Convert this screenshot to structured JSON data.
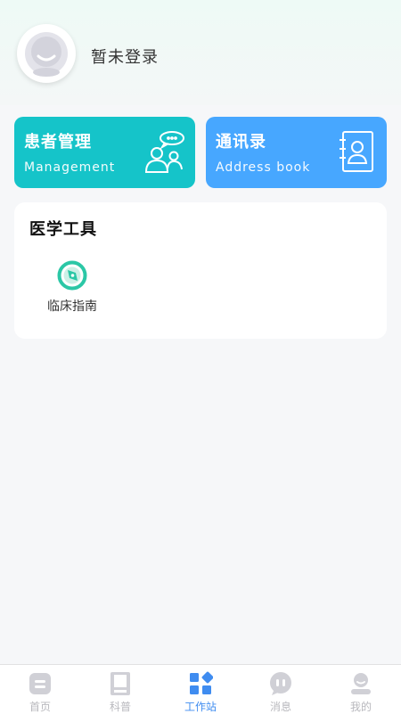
{
  "profile": {
    "login_status": "暂未登录"
  },
  "cards": {
    "patients": {
      "title": "患者管理",
      "subtitle": "Management",
      "color": "#15c4c9"
    },
    "contacts": {
      "title": "通讯录",
      "subtitle": "Address book",
      "color": "#47a7ff"
    }
  },
  "tools": {
    "title": "医学工具",
    "items": [
      {
        "label": "临床指南",
        "icon": "compass-icon"
      }
    ]
  },
  "tabbar": {
    "active": "工作站",
    "items": [
      {
        "label": "首页",
        "icon": "home-icon"
      },
      {
        "label": "科普",
        "icon": "book-icon"
      },
      {
        "label": "工作站",
        "icon": "workstation-icon"
      },
      {
        "label": "消息",
        "icon": "message-icon"
      },
      {
        "label": "我的",
        "icon": "profile-icon"
      }
    ]
  },
  "colors": {
    "accent": "#3f8cf0",
    "tool_icon": "#2bc7a6",
    "inactive": "#b8b8bd"
  }
}
